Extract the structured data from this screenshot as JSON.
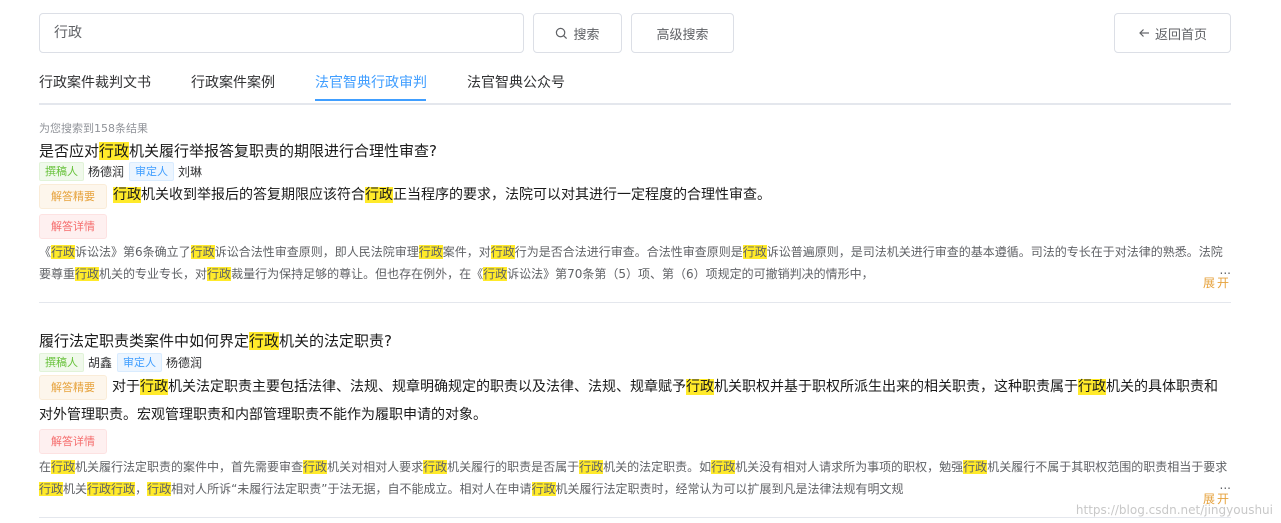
{
  "search": {
    "query": "行政",
    "search_label": "搜索",
    "advanced_label": "高级搜索",
    "home_label": "返回首页"
  },
  "tabs": [
    {
      "label": "行政案件裁判文书"
    },
    {
      "label": "行政案件案例"
    },
    {
      "label": "法官智典行政审判",
      "active": true
    },
    {
      "label": "法官智典公众号"
    }
  ],
  "results": {
    "count_text": "为您搜索到158条结果",
    "author_tag": "撰稿人",
    "reviewer_tag": "审定人",
    "summary_label": "解答精要",
    "detail_label": "解答详情",
    "expand_label": "展开",
    "ellipsis": "...",
    "highlight_color": "#ffea2a",
    "items": [
      {
        "title": "是否应对行政机关履行举报答复职责的期限进行合理性审查?",
        "author": "杨德润",
        "reviewer": "刘琳",
        "summary": "行政机关收到举报后的答复期限应该符合行政正当程序的要求，法院可以对其进行一定程度的合理性审查。",
        "detail": "《行政诉讼法》第6条确立了行政诉讼合法性审查原则，即人民法院审理行政案件，对行政行为是否合法进行审查。合法性审查原则是行政诉讼普遍原则，是司法机关进行审查的基本遵循。司法的专长在于对法律的熟悉。法院要尊重行政机关的专业专长，对行政裁量行为保持足够的尊让。但也存在例外，在《行政诉讼法》第70条第（5）项、第（6）项规定的可撤销判决的情形中，"
      },
      {
        "title": "履行法定职责类案件中如何界定行政机关的法定职责?",
        "author": "胡鑫",
        "reviewer": "杨德润",
        "summary": "对于行政机关法定职责主要包括法律、法规、规章明确规定的职责以及法律、法规、规章赋予行政机关职权并基于职权所派生出来的相关职责，这种职责属于行政机关的具体职责和对外管理职责。宏观管理职责和内部管理职责不能作为履职申请的对象。",
        "detail": "在行政机关履行法定职责的案件中，首先需要审查行政机关对相对人要求行政机关履行的职责是否属于行政机关的法定职责。如行政机关没有相对人请求所为事项的职权，勉强行政机关履行不属于其职权范围的职责相当于要求行政机关行政行政，行政相对人所诉“未履行法定职责”于法无据，自不能成立。相对人在申请行政机关履行法定职责时，经常认为可以扩展到凡是法律法规有明文规"
      }
    ]
  },
  "watermark": "https://blog.csdn.net/jingyoushui"
}
